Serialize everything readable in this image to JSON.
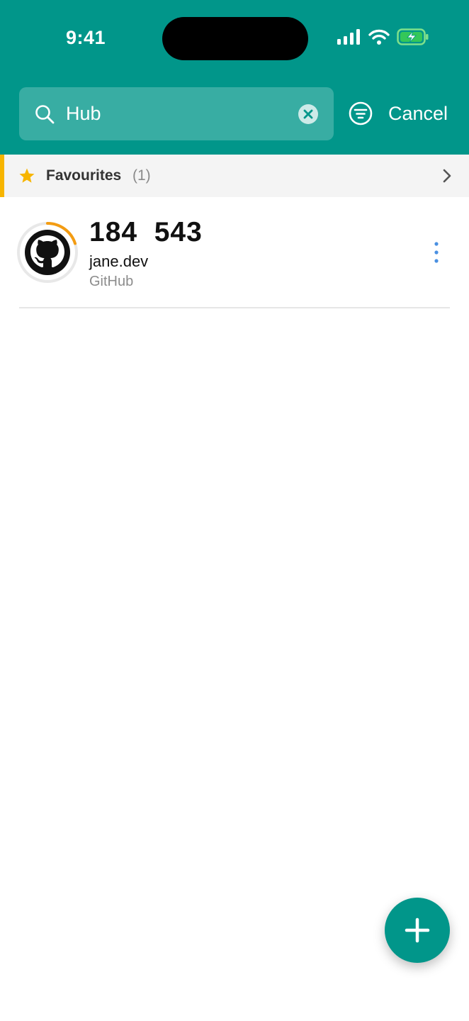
{
  "status_bar": {
    "time": "9:41",
    "icons": [
      "signal-icon",
      "wifi-icon",
      "battery-charging-icon"
    ]
  },
  "search": {
    "value": "Hub",
    "placeholder": "Search",
    "cancel_label": "Cancel"
  },
  "favourites": {
    "label": "Favourites",
    "count": "(1)"
  },
  "entries": [
    {
      "code": "184  543",
      "account": "jane.dev",
      "issuer": "GitHub",
      "timer_progress": 0.2,
      "icon": "github-logo"
    }
  ],
  "colors": {
    "primary": "#01968A",
    "favourite_accent": "#F7B500",
    "timer": "#F39C12",
    "menu_dots": "#4A90E2"
  }
}
